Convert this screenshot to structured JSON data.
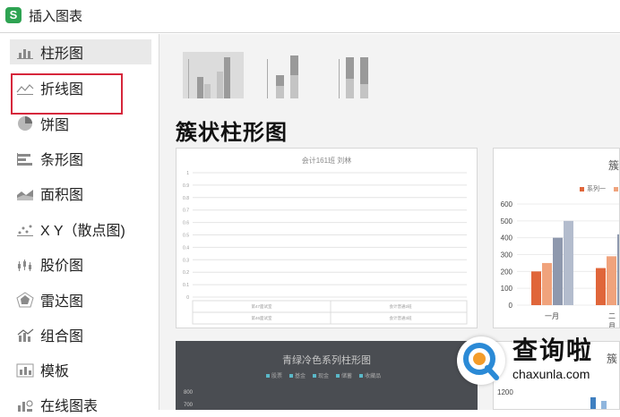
{
  "window": {
    "title": "插入图表",
    "app_icon_letter": "S"
  },
  "sidebar": {
    "items": [
      {
        "label": "柱形图",
        "icon": "column-chart-icon",
        "active": true
      },
      {
        "label": "折线图",
        "icon": "line-chart-icon",
        "active": false
      },
      {
        "label": "饼图",
        "icon": "pie-chart-icon",
        "active": false
      },
      {
        "label": "条形图",
        "icon": "bar-chart-icon",
        "active": false
      },
      {
        "label": "面积图",
        "icon": "area-chart-icon",
        "active": false
      },
      {
        "label": "X Y（散点图)",
        "icon": "scatter-chart-icon",
        "active": false
      },
      {
        "label": "股价图",
        "icon": "stock-chart-icon",
        "active": false
      },
      {
        "label": "雷达图",
        "icon": "radar-chart-icon",
        "active": false
      },
      {
        "label": "组合图",
        "icon": "combo-chart-icon",
        "active": false
      },
      {
        "label": "模板",
        "icon": "template-icon",
        "active": false
      },
      {
        "label": "在线图表",
        "icon": "online-chart-icon",
        "active": false
      }
    ]
  },
  "main": {
    "heading": "簇状柱形图",
    "cards": {
      "c1": {
        "title": "会计161班  刘林",
        "yticks": [
          "1",
          "0.9",
          "0.8",
          "0.7",
          "0.6",
          "0.5",
          "0.4",
          "0.3",
          "0.2",
          "0.1",
          "0"
        ],
        "table": [
          [
            "第47面试室",
            "会计普通2班"
          ],
          [
            "第46面试室",
            "会计普通3班"
          ]
        ]
      },
      "c2": {
        "title": "簇",
        "legend": "系列一",
        "yticks": [
          "600",
          "500",
          "400",
          "300",
          "200",
          "100",
          "0"
        ],
        "xlabels": [
          "一月",
          "二月"
        ]
      },
      "c3": {
        "title": "青绿冷色系列柱形图",
        "legend": [
          "股票",
          "基金",
          "现金",
          "储蓄",
          "收藏品"
        ],
        "yticks": [
          "800",
          "700"
        ]
      },
      "c4": {
        "title": "簇",
        "ytick": "1200"
      }
    }
  },
  "watermark": {
    "cn": "查询啦",
    "en": "chaxunla.com"
  },
  "colors": {
    "accent_red": "#d6263b",
    "bar_orange": "#e0663a",
    "bar_light_orange": "#f0a37c",
    "bar_slate": "#8e98ad",
    "bar_light_slate": "#b3bccd",
    "app_green": "#2ea352"
  }
}
